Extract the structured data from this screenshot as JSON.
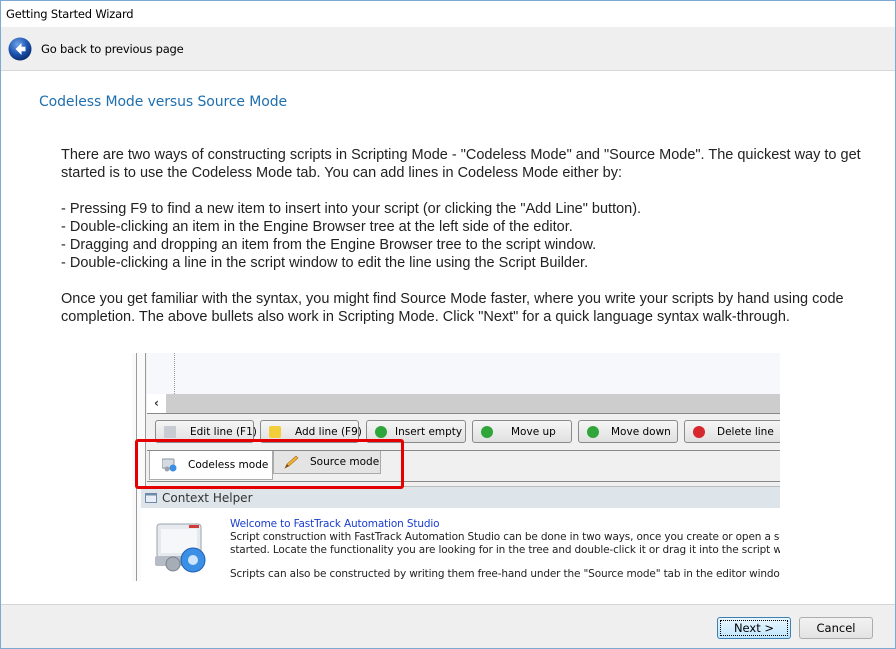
{
  "window": {
    "title": "Getting Started Wizard"
  },
  "nav": {
    "back_label": "Go back to previous page",
    "back_icon": "arrow-left-circle-icon"
  },
  "page": {
    "heading": "Codeless Mode versus Source Mode",
    "intro": "There are two ways of constructing scripts in Scripting Mode - \"Codeless Mode\" and \"Source Mode\". The quickest way to get started is to use the Codeless Mode tab. You can add lines in Codeless Mode either by:",
    "bullets": [
      "- Pressing F9 to find a new item to insert into your script (or clicking the \"Add Line\" button).",
      "- Double-clicking an item in the Engine Browser tree at the left side of the editor.",
      "- Dragging and dropping an item from the Engine Browser tree to the script window.",
      "- Double-clicking a line in the script window to edit the line using the Script Builder."
    ],
    "outro": "Once you get familiar with the syntax, you might find Source Mode faster, where you write your scripts by hand using code completion. The above bullets also work in Scripting Mode. Click \"Next\" for a quick language syntax walk-through."
  },
  "screenshot": {
    "scroll_left_glyph": "‹",
    "toolbar": [
      {
        "label": "Edit line (F1)",
        "icon": "pencil-page-icon",
        "color": "#c8ccd2"
      },
      {
        "label": "Add line (F9)",
        "icon": "folder-icon",
        "color": "#f2cf3a"
      },
      {
        "label": "Insert empty",
        "icon": "plus-circle-icon",
        "color": "#2fa53a"
      },
      {
        "label": "Move up",
        "icon": "arrow-up-circle-icon",
        "color": "#2fa53a"
      },
      {
        "label": "Move down",
        "icon": "arrow-down-circle-icon",
        "color": "#2fa53a"
      },
      {
        "label": "Delete line",
        "icon": "x-circle-icon",
        "color": "#d8282f"
      }
    ],
    "tabs": [
      {
        "label": "Codeless mode",
        "active": true,
        "icon": "codeless-gear-icon"
      },
      {
        "label": "Source mode",
        "active": false,
        "icon": "pencil-icon"
      }
    ],
    "helper": {
      "title": "Context Helper",
      "link": "Welcome to FastTrack Automation Studio",
      "lines": [
        "Script construction with FastTrack Automation Studio can be done in two ways, once you create or open a script. I",
        "started. Locate the functionality you are looking for in the tree and double-click it or drag it into the script window t"
      ],
      "line3": "Scripts can also be constructed by writing them free-hand under the \"Source mode\" tab in the editor window, which"
    },
    "highlight_color": "#e40000"
  },
  "footer": {
    "next_label": "Next >",
    "cancel_label": "Cancel"
  }
}
